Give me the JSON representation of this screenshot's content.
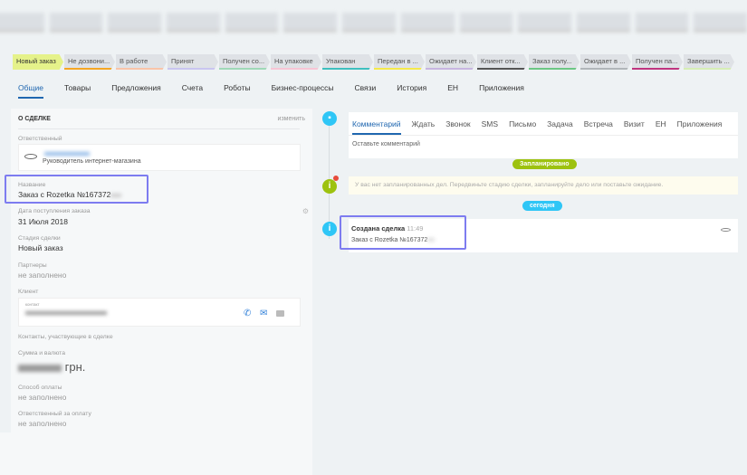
{
  "stages": [
    {
      "label": "Новый заказ",
      "color": "#e5f28a"
    },
    {
      "label": "Не дозвони...",
      "color": "#f5a623"
    },
    {
      "label": "В работе",
      "color": "#f9c4a8"
    },
    {
      "label": "Принят",
      "color": "#c9c5f0"
    },
    {
      "label": "Получен со...",
      "color": "#9fd8b7"
    },
    {
      "label": "На упаковке",
      "color": "#f7c5d5"
    },
    {
      "label": "Упакован",
      "color": "#3fbfbf"
    },
    {
      "label": "Передан в ...",
      "color": "#f5e94a"
    },
    {
      "label": "Ожидает на...",
      "color": "#c7b5e0"
    },
    {
      "label": "Клиент отк...",
      "color": "#555555"
    },
    {
      "label": "Заказ полу...",
      "color": "#6cc784"
    },
    {
      "label": "Ожидает в ...",
      "color": "#b0b5b9"
    },
    {
      "label": "Получен па...",
      "color": "#c0357f"
    },
    {
      "label": "Завершить ...",
      "color": "#d6eeb5"
    }
  ],
  "tabs": [
    "Общие",
    "Товары",
    "Предложения",
    "Счета",
    "Роботы",
    "Бизнес-процессы",
    "Связи",
    "История",
    "ЕН",
    "Приложения"
  ],
  "deal": {
    "section_title": "О СДЕЛКЕ",
    "edit_label": "изменить",
    "responsible_label": "Ответственный",
    "responsible_position": "Руководитель интернет-магазина",
    "name_label": "Название",
    "name_value": "Заказ с Rozetka №167372",
    "date_label": "Дата поступления заказа",
    "date_value": "31 Июля 2018",
    "stage_label": "Стадия сделки",
    "stage_value": "Новый заказ",
    "partners_label": "Партнеры",
    "partners_value": "не заполнено",
    "client_label": "Клиент",
    "client_sub": "контакт",
    "contacts_label": "Контакты, участвующие в сделке",
    "sum_label": "Сумма и валюта",
    "currency": "грн.",
    "payment_label": "Способ оплаты",
    "payment_value": "не заполнено",
    "pay_resp_label": "Ответственный за оплату",
    "pay_resp_value": "не заполнено"
  },
  "timeline": {
    "tabs": [
      "Комментарий",
      "Ждать",
      "Звонок",
      "SMS",
      "Письмо",
      "Задача",
      "Встреча",
      "Визит",
      "ЕН",
      "Приложения"
    ],
    "comment_placeholder": "Оставьте комментарий",
    "planned_badge": "Запланировано",
    "no_tasks_text": "У вас нет запланированных дел. Передвиньте стадию сделки, запланируйте дело или поставьте ожидание.",
    "today_badge": "сегодня",
    "event_title": "Создана сделка",
    "event_time": "11:49",
    "event_text": "Заказ с Rozetka №167372"
  },
  "colors": {
    "accent": "#2067b0",
    "green": "#9dc20f",
    "blue": "#2fc6f6",
    "highlight": "#7d7cf0"
  }
}
